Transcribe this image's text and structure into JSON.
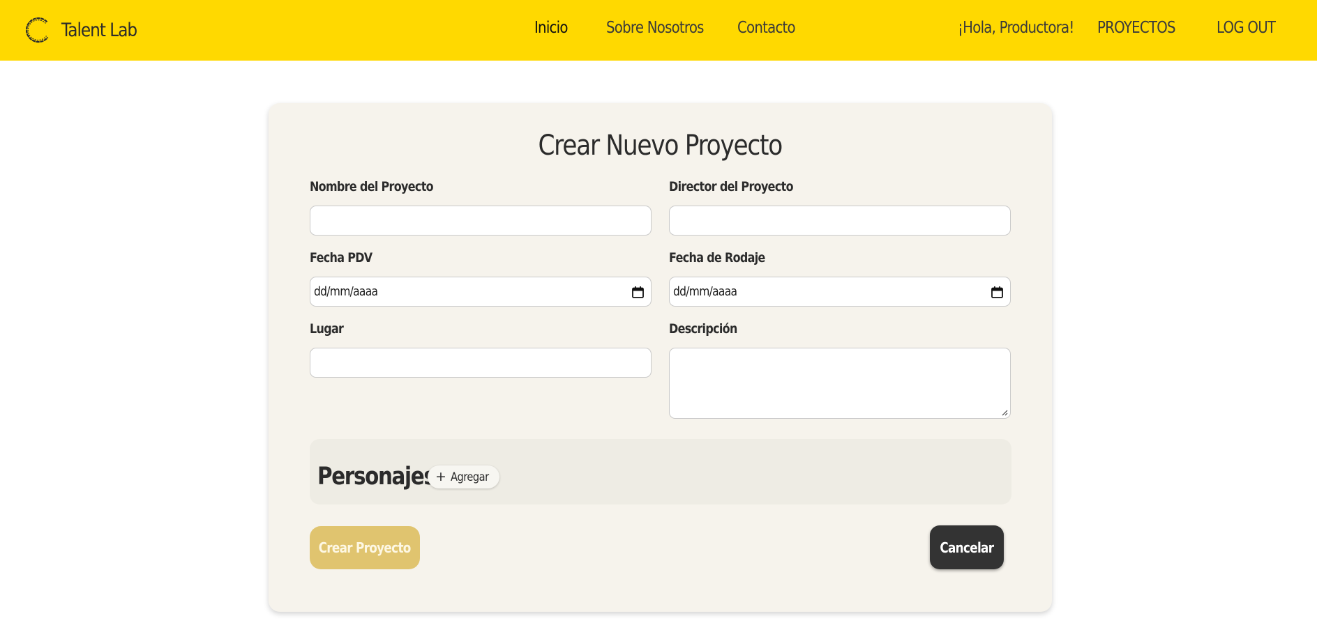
{
  "colors": {
    "navbar_bg": "#ffd900",
    "card_bg": "#f6f3ec",
    "section_bg": "#eeece4",
    "primary_button": "#e0c46f",
    "secondary_button": "#333333"
  },
  "header": {
    "brand": {
      "name": "Talent Lab",
      "icon": "circle-logo-icon"
    },
    "nav": {
      "inicio": "Inicio",
      "sobre": "Sobre Nosotros",
      "contacto": "Contacto"
    },
    "greeting": "¡Hola, Productora!",
    "proyectos": "PROYECTOS",
    "logout": "LOG OUT"
  },
  "form": {
    "title": "Crear Nuevo Proyecto",
    "fields": {
      "nombre": {
        "label": "Nombre del Proyecto",
        "value": ""
      },
      "director": {
        "label": "Director del Proyecto",
        "value": ""
      },
      "fecha_pdv": {
        "label": "Fecha PDV",
        "value": "dd/mm/aaaa",
        "icon": "calendar-icon"
      },
      "fecha_rodaje": {
        "label": "Fecha de Rodaje",
        "value": "dd/mm/aaaa",
        "icon": "calendar-icon"
      },
      "lugar": {
        "label": "Lugar",
        "value": ""
      },
      "descripcion": {
        "label": "Descripción",
        "value": ""
      }
    },
    "personajes": {
      "title": "Personajes",
      "add_label": "Agregar",
      "add_icon": "plus-icon"
    },
    "actions": {
      "create": "Crear Proyecto",
      "cancel": "Cancelar"
    }
  }
}
